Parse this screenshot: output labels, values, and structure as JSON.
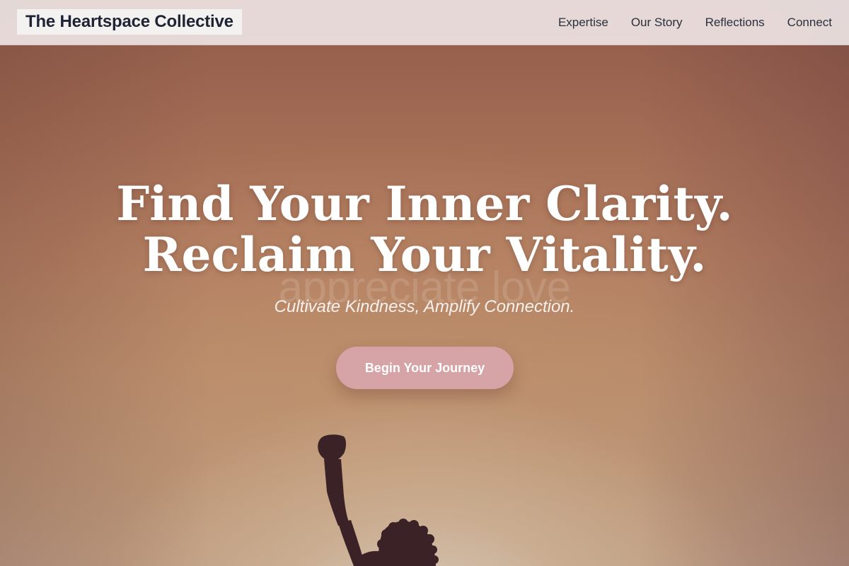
{
  "header": {
    "brand": "The Heartspace Collective",
    "nav": [
      {
        "label": "Expertise"
      },
      {
        "label": "Our Story"
      },
      {
        "label": "Reflections"
      },
      {
        "label": "Connect"
      }
    ]
  },
  "hero": {
    "headline_line1": "Find Your Inner Clarity.",
    "headline_line2": "Reclaim Your Vitality.",
    "watermark_text": "appreciate love",
    "subheadline": "Cultivate Kindness, Amplify Connection.",
    "cta_label": "Begin Your Journey"
  },
  "colors": {
    "header_bg": "#ece2e2",
    "brand_text": "#1e2433",
    "cta_bg": "#d6a3a6",
    "headline": "#ffffff"
  },
  "icons": {
    "hero_figure": "raised-fist-silhouette"
  }
}
